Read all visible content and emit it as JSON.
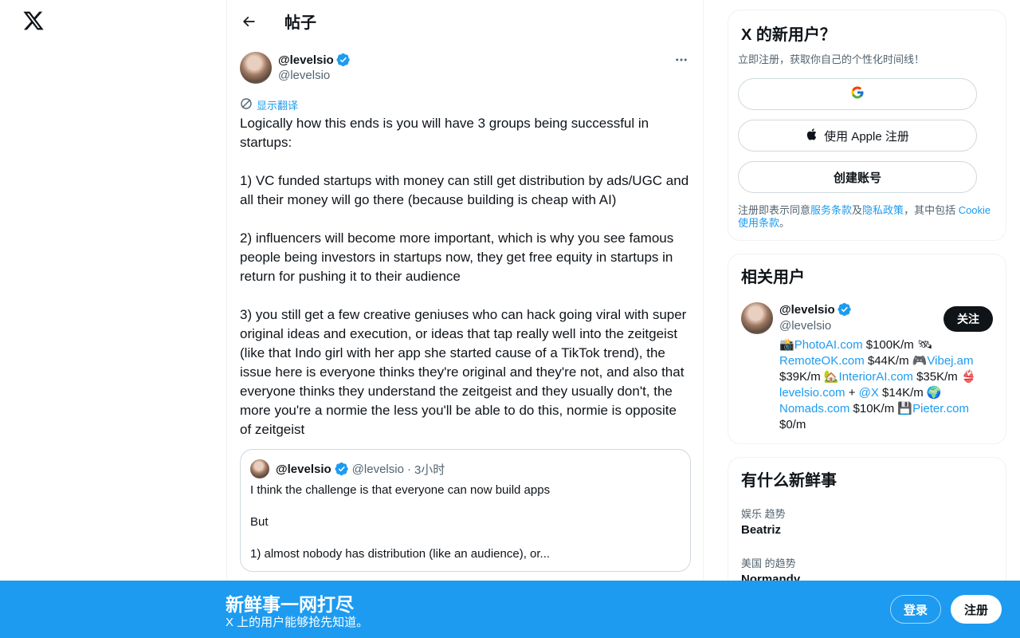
{
  "header": {
    "title": "帖子"
  },
  "tweet": {
    "author_name": "@levelsio",
    "author_handle": "@levelsio",
    "translate_label": "显示翻译",
    "text": "Logically how this ends is you will have 3 groups being successful in startups:\n\n1) VC funded startups with money can still get distribution by ads/UGC and all their money will go there (because building is cheap with AI)\n\n2) influencers will become more important, which is why you see famous people being investors in startups now, they get free equity in startups in return for pushing it to their audience\n\n3) you still get a few creative geniuses who can hack going viral with super original ideas and execution, or ideas that tap really well into the zeitgeist (like that Indo girl with her app she started cause of a TikTok trend), the issue here is everyone thinks they're original and they're not, and also that everyone thinks they understand the zeitgeist and they usually don't, the more you're a normie the less you'll be able to do this, normie is opposite of zeitgeist",
    "quote": {
      "name": "@levelsio",
      "handle": "@levelsio",
      "dot": "·",
      "time": "3小时",
      "text": "I think the challenge is that everyone can now build apps\n\nBut\n\n1) almost nobody has distribution (like an audience), or..."
    }
  },
  "signup": {
    "title": "X 的新用户？",
    "subtitle": "立即注册，获取你自己的个性化时间线！",
    "apple_label": "使用 Apple 注册",
    "create_label": "创建账号",
    "terms_prefix": "注册即表示同意",
    "terms_link": "服务条款",
    "terms_and": "及",
    "privacy_link": "隐私政策",
    "terms_mid": "，其中包括 ",
    "cookie_link": "Cookie 使用条款",
    "terms_end": "。"
  },
  "related": {
    "title": "相关用户",
    "name": "@levelsio",
    "handle": "@levelsio",
    "follow_label": "关注",
    "bio": [
      {
        "t": "📸"
      },
      {
        "l": "PhotoAI.com"
      },
      {
        "t": " $100K/m 🛰 "
      },
      {
        "l": "RemoteOK.com"
      },
      {
        "t": " $44K/m 🎮"
      },
      {
        "l": "Vibej.am"
      },
      {
        "t": " $39K/m 🏡"
      },
      {
        "l": "InteriorAI.com"
      },
      {
        "t": " $35K/m 👙 "
      },
      {
        "l": "levelsio.com"
      },
      {
        "t": " + "
      },
      {
        "l": "@X"
      },
      {
        "t": " $14K/m 🌍 "
      },
      {
        "l": "Nomads.com"
      },
      {
        "t": " $10K/m 💾"
      },
      {
        "l": "Pieter.com"
      },
      {
        "t": " $0/m"
      }
    ]
  },
  "trends": {
    "title": "有什么新鲜事",
    "items": [
      {
        "meta": "娱乐 趋势",
        "name": "Beatriz"
      },
      {
        "meta": "美国 的趋势",
        "name": "Normandy"
      }
    ]
  },
  "bottombar": {
    "title": "新鲜事一网打尽",
    "subtitle": "X 上的用户能够抢先知道。",
    "login_label": "登录",
    "register_label": "注册"
  }
}
